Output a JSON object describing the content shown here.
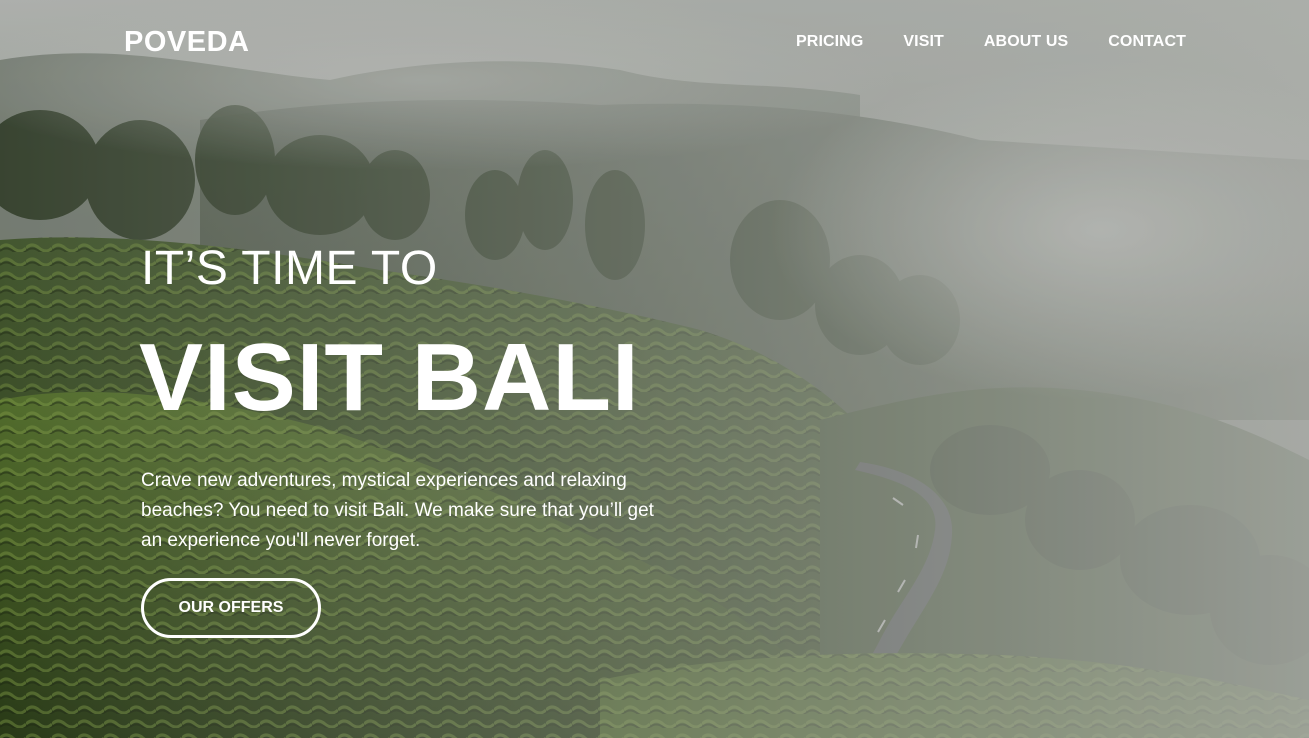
{
  "brand": {
    "name": "POVEDA"
  },
  "nav": {
    "items": [
      {
        "label": "PRICING"
      },
      {
        "label": "VISIT"
      },
      {
        "label": "ABOUT US"
      },
      {
        "label": "CONTACT"
      }
    ]
  },
  "hero": {
    "kicker": "IT’S TIME TO",
    "headline": "VISIT BALI",
    "lead": "Crave new adventures, mystical experiences and relaxing beaches? You need to visit Bali. We make sure that you’ll get an experience you'll never forget.",
    "cta_label": "OUR OFFERS",
    "background_image": "misty-tea-plantation-hills-with-road"
  },
  "colors": {
    "text": "#ffffff",
    "mist": "#c9ccc8",
    "foliage_dark": "#26331f",
    "foliage_light": "#6e8a3f",
    "road": "#55575a"
  }
}
